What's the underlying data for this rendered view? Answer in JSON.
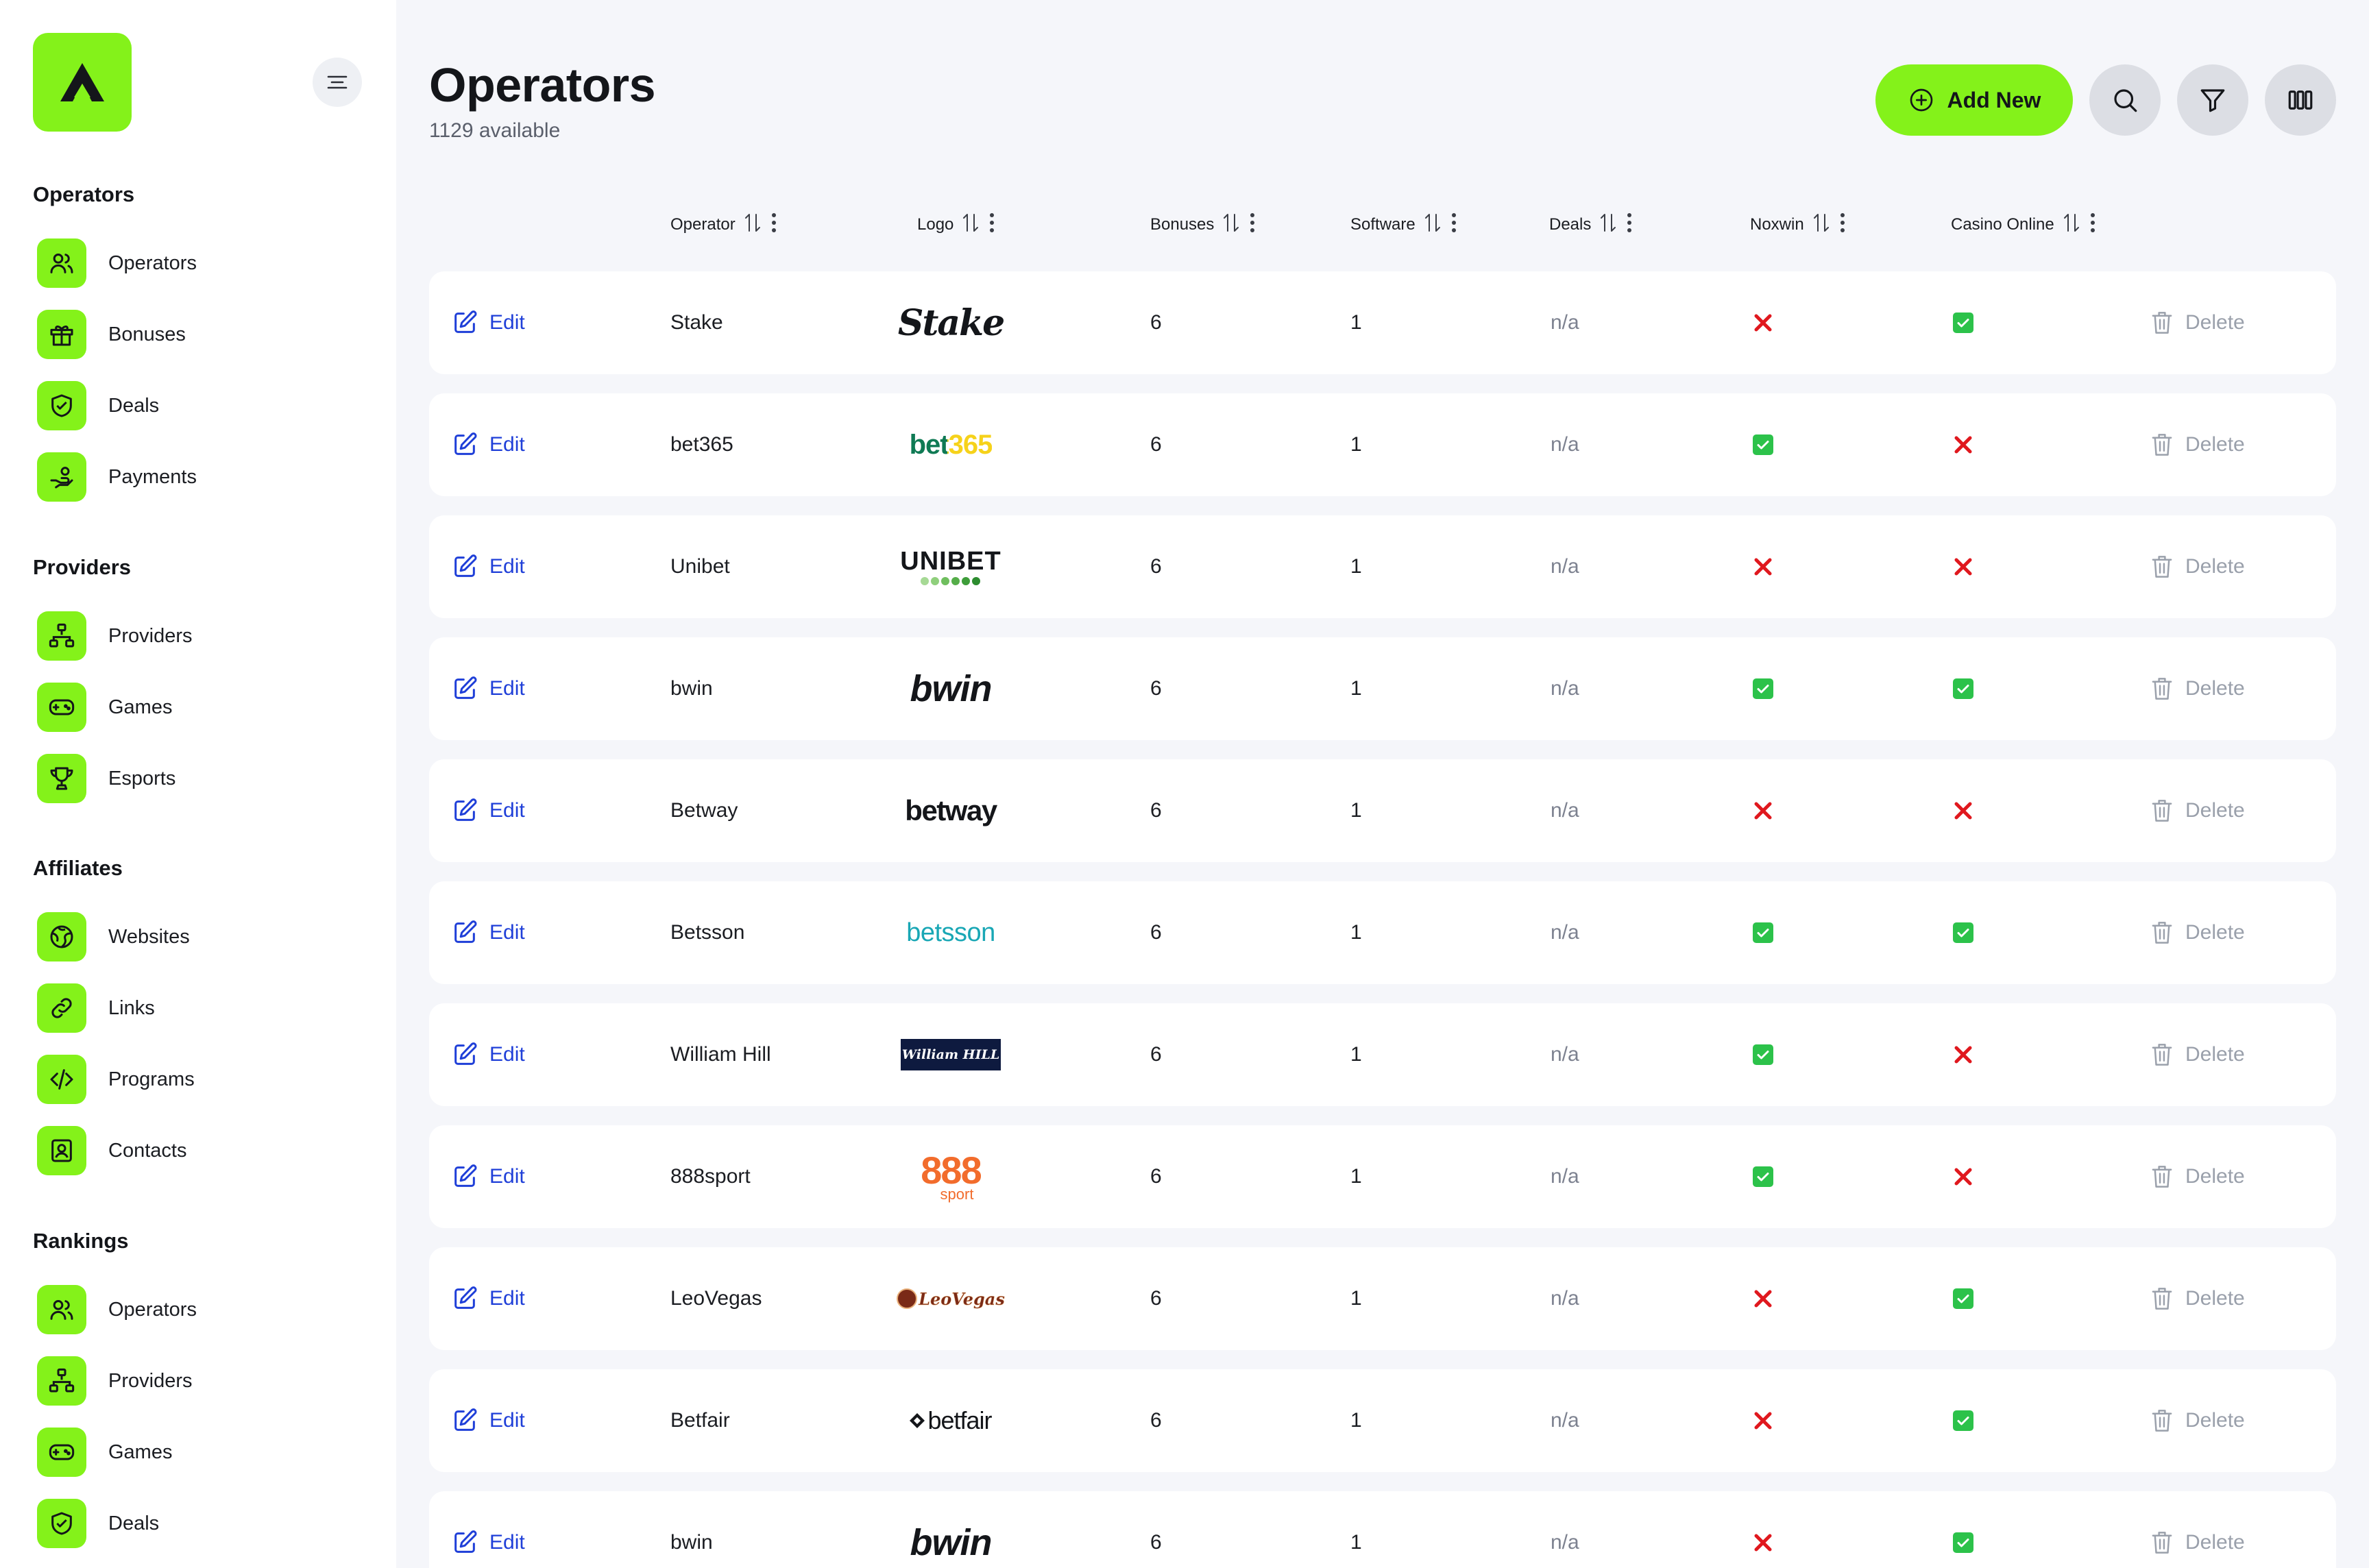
{
  "sidebar": {
    "sections": [
      {
        "title": "Operators",
        "items": [
          {
            "label": "Operators",
            "icon": "users-icon"
          },
          {
            "label": "Bonuses",
            "icon": "gift-icon"
          },
          {
            "label": "Deals",
            "icon": "handshake-icon"
          },
          {
            "label": "Payments",
            "icon": "hand-coins-icon"
          }
        ]
      },
      {
        "title": "Providers",
        "items": [
          {
            "label": "Providers",
            "icon": "hierarchy-icon"
          },
          {
            "label": "Games",
            "icon": "gamepad-icon"
          },
          {
            "label": "Esports",
            "icon": "trophy-icon"
          }
        ]
      },
      {
        "title": "Affiliates",
        "items": [
          {
            "label": "Websites",
            "icon": "globe-icon"
          },
          {
            "label": "Links",
            "icon": "link-icon"
          },
          {
            "label": "Programs",
            "icon": "code-icon"
          },
          {
            "label": "Contacts",
            "icon": "contact-card-icon"
          }
        ]
      },
      {
        "title": "Rankings",
        "items": [
          {
            "label": "Operators",
            "icon": "users-icon"
          },
          {
            "label": "Providers",
            "icon": "hierarchy-icon"
          },
          {
            "label": "Games",
            "icon": "gamepad-icon"
          },
          {
            "label": "Deals",
            "icon": "handshake-icon"
          }
        ]
      }
    ]
  },
  "header": {
    "title": "Operators",
    "subtitle": "1129 available",
    "add_label": "Add New"
  },
  "table": {
    "columns": [
      "Operator",
      "Logo",
      "Bonuses",
      "Software",
      "Deals",
      "Noxwin",
      "Casino Online"
    ],
    "edit_label": "Edit",
    "delete_label": "Delete",
    "rows": [
      {
        "name": "Stake",
        "logo": "Stake",
        "bonuses": "6",
        "software": "1",
        "deals": "n/a",
        "noxwin": false,
        "casino": true
      },
      {
        "name": "bet365",
        "logo": "bet365",
        "bonuses": "6",
        "software": "1",
        "deals": "n/a",
        "noxwin": true,
        "casino": false
      },
      {
        "name": "Unibet",
        "logo": "UNIBET",
        "bonuses": "6",
        "software": "1",
        "deals": "n/a",
        "noxwin": false,
        "casino": false
      },
      {
        "name": "bwin",
        "logo": "bwin",
        "bonuses": "6",
        "software": "1",
        "deals": "n/a",
        "noxwin": true,
        "casino": true
      },
      {
        "name": "Betway",
        "logo": "betway",
        "bonuses": "6",
        "software": "1",
        "deals": "n/a",
        "noxwin": false,
        "casino": false
      },
      {
        "name": "Betsson",
        "logo": "betsson",
        "bonuses": "6",
        "software": "1",
        "deals": "n/a",
        "noxwin": true,
        "casino": true
      },
      {
        "name": "William Hill",
        "logo": "William HILL",
        "bonuses": "6",
        "software": "1",
        "deals": "n/a",
        "noxwin": true,
        "casino": false
      },
      {
        "name": "888sport",
        "logo": "888",
        "bonuses": "6",
        "software": "1",
        "deals": "n/a",
        "noxwin": true,
        "casino": false
      },
      {
        "name": "LeoVegas",
        "logo": "LeoVegas",
        "bonuses": "6",
        "software": "1",
        "deals": "n/a",
        "noxwin": false,
        "casino": true
      },
      {
        "name": "Betfair",
        "logo": "betfair",
        "bonuses": "6",
        "software": "1",
        "deals": "n/a",
        "noxwin": false,
        "casino": true
      },
      {
        "name": "bwin",
        "logo": "bwin",
        "bonuses": "6",
        "software": "1",
        "deals": "n/a",
        "noxwin": false,
        "casino": true
      }
    ]
  },
  "logo_extras": {
    "sport": "sport"
  },
  "colors": {
    "accent": "#84f21a",
    "link": "#1f3fd8",
    "check": "#2cc24a",
    "cross": "#e0181e",
    "background": "#f5f6fa"
  }
}
